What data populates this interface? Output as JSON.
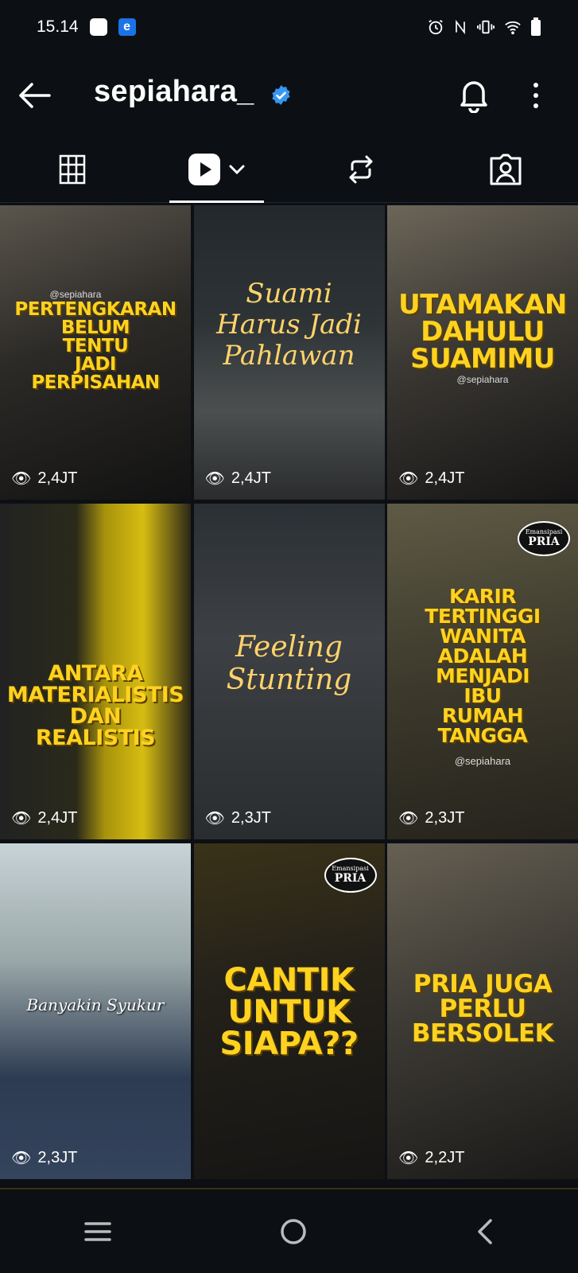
{
  "status_bar": {
    "time": "15.14",
    "icons": [
      "notification-square-icon",
      "e-app-icon",
      "alarm-icon",
      "nfc-icon",
      "vibrate-icon",
      "wifi-icon",
      "battery-icon"
    ]
  },
  "header": {
    "username": "sepiahara_",
    "verified": true,
    "icons": [
      "back-arrow-icon",
      "verified-badge-icon",
      "bell-icon",
      "more-vertical-icon"
    ]
  },
  "tabs": [
    {
      "name": "posts-grid",
      "icon": "grid-icon",
      "active": false
    },
    {
      "name": "reels",
      "icon": "reels-play-icon",
      "active": true
    },
    {
      "name": "reposts",
      "icon": "repost-icon",
      "active": false
    },
    {
      "name": "tagged",
      "icon": "tagged-person-icon",
      "active": false
    }
  ],
  "reels": [
    {
      "title_lines": [
        "PERTENGKARAN",
        "BELUM",
        "TENTU",
        "JADI",
        "PERPISAHAN"
      ],
      "handle": "@sepiahara",
      "views": "2,4JT",
      "style": "bold"
    },
    {
      "title_lines": [
        "Suami",
        "Harus Jadi",
        "Pahlawan"
      ],
      "handle": "",
      "views": "2,4JT",
      "style": "script"
    },
    {
      "title_lines": [
        "UTAMAKAN",
        "DAHULU",
        "SUAMIMU"
      ],
      "handle": "@sepiahara",
      "views": "2,4JT",
      "style": "bold"
    },
    {
      "title_lines": [
        "ANTARA",
        "MATERIALISTIS",
        "DAN",
        "REALISTIS"
      ],
      "handle": "",
      "views": "2,4JT",
      "style": "bold"
    },
    {
      "title_lines": [
        "Feeling",
        "Stunting"
      ],
      "handle": "",
      "views": "2,3JT",
      "style": "script"
    },
    {
      "title_lines": [
        "KARIR",
        "TERTINGGI",
        "WANITA",
        "ADALAH",
        "MENJADI",
        "IBU",
        "RUMAH",
        "TANGGA"
      ],
      "handle": "@sepiahara",
      "views": "2,3JT",
      "style": "bold",
      "badge": {
        "top": "Emansipasi",
        "bottom": "PRIA"
      }
    },
    {
      "title_lines": [
        "Banyakin Syukur"
      ],
      "handle": "",
      "views": "2,3JT",
      "style": "script"
    },
    {
      "title_lines": [
        "CANTIK",
        "UNTUK",
        "SIAPA??"
      ],
      "handle": "",
      "views": "",
      "style": "bold",
      "badge": {
        "top": "Emansipasi",
        "bottom": "PRIA"
      }
    },
    {
      "title_lines": [
        "PRIA JUGA",
        "PERLU",
        "BERSOLEK"
      ],
      "handle": "",
      "views": "2,2JT",
      "style": "bold"
    }
  ],
  "nav_bar": {
    "icons": [
      "recent-apps-icon",
      "home-circle-icon",
      "back-chevron-icon"
    ]
  }
}
